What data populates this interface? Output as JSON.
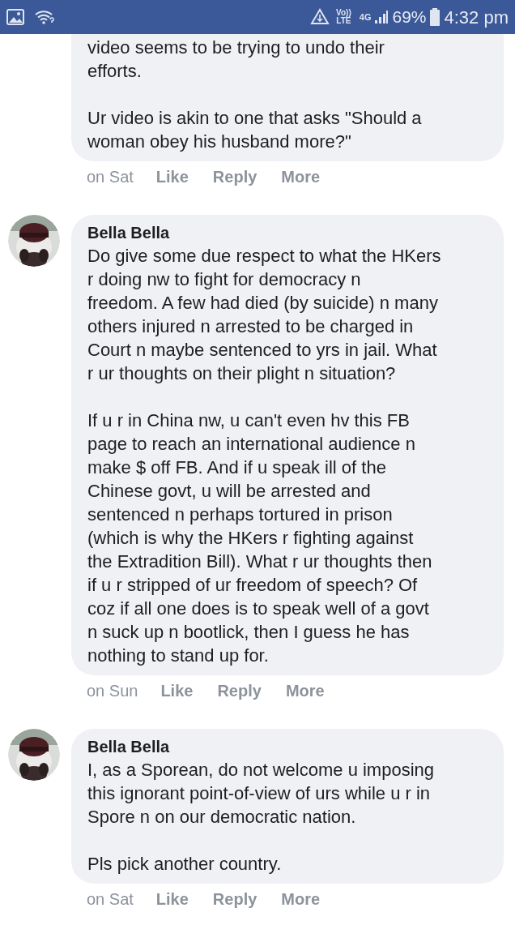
{
  "status_bar": {
    "volte_top": "Vo))",
    "volte_bottom": "LTE",
    "network": "4G",
    "battery": "69%",
    "time": "4:32 pm"
  },
  "comments": [
    {
      "paragraphs": [
        "video seems to be trying to undo their\nefforts.",
        "Ur video is akin to one that asks \"Should a\nwoman obey his husband more?\""
      ],
      "time": "on Sat",
      "actions": [
        "Like",
        "Reply",
        "More"
      ]
    },
    {
      "author": "Bella Bella",
      "paragraphs": [
        "Do give some due respect to what the HKers\nr doing nw to fight for democracy n\nfreedom. A few had died (by suicide) n many\nothers injured n arrested to be charged in\nCourt n maybe sentenced to yrs in jail. What\nr ur thoughts on their plight n situation?",
        "If u r in China nw, u can't even hv this FB\npage to reach an international audience n\nmake $ off FB. And if u speak ill of the\nChinese govt, u will be arrested and\nsentenced n perhaps tortured in prison\n(which is why the HKers r fighting against\nthe Extradition Bill). What r ur thoughts then\nif u r stripped of ur freedom of speech? Of\ncoz if all one does is to speak well of a govt\nn suck up n bootlick, then I guess he has\nnothing to stand up for."
      ],
      "time": "on Sun",
      "actions": [
        "Like",
        "Reply",
        "More"
      ]
    },
    {
      "author": "Bella Bella",
      "paragraphs": [
        "I, as a Sporean, do not welcome u imposing\nthis ignorant point-of-view of urs while u r in\nSpore n on our democratic nation.",
        "Pls pick another country."
      ],
      "time": "on Sat",
      "actions": [
        "Like",
        "Reply",
        "More"
      ]
    }
  ]
}
